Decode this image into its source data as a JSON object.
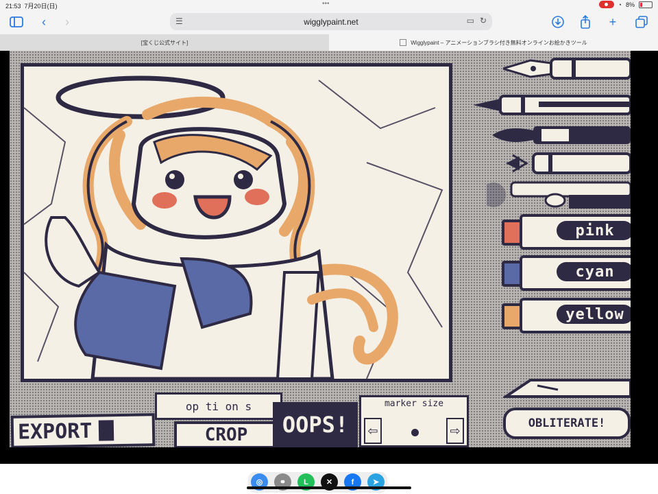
{
  "status": {
    "time": "21:53",
    "date": "7月20日(日)",
    "battery": "8%"
  },
  "browser": {
    "url": "wigglypaint.net",
    "tabs": [
      {
        "label": "[宝くじ公式サイト]"
      },
      {
        "label": "Wigglypaint – アニメーションブラシ付き無料オンラインお絵かきツール"
      }
    ]
  },
  "app": {
    "markers": [
      {
        "label": "pink",
        "color": "#e0705a"
      },
      {
        "label": "cyan",
        "color": "#5a6aa6"
      },
      {
        "label": "yellow",
        "color": "#e8a86a"
      }
    ],
    "buttons": {
      "export": "EXPORT",
      "options": "op ti on s",
      "crop": "CROP",
      "oops": "OOPS!",
      "marker_size": "marker size",
      "obliterate": "OBLITERATE!"
    }
  },
  "share": {
    "items": [
      "airdrop-icon",
      "link-icon",
      "line-icon",
      "x-icon",
      "facebook-icon",
      "telegram-icon"
    ]
  },
  "colors": {
    "ink": "#2f2a44",
    "paper": "#f4f0e6",
    "orange": "#e8a86a",
    "blue": "#5a6aa6",
    "red": "#e0705a"
  }
}
